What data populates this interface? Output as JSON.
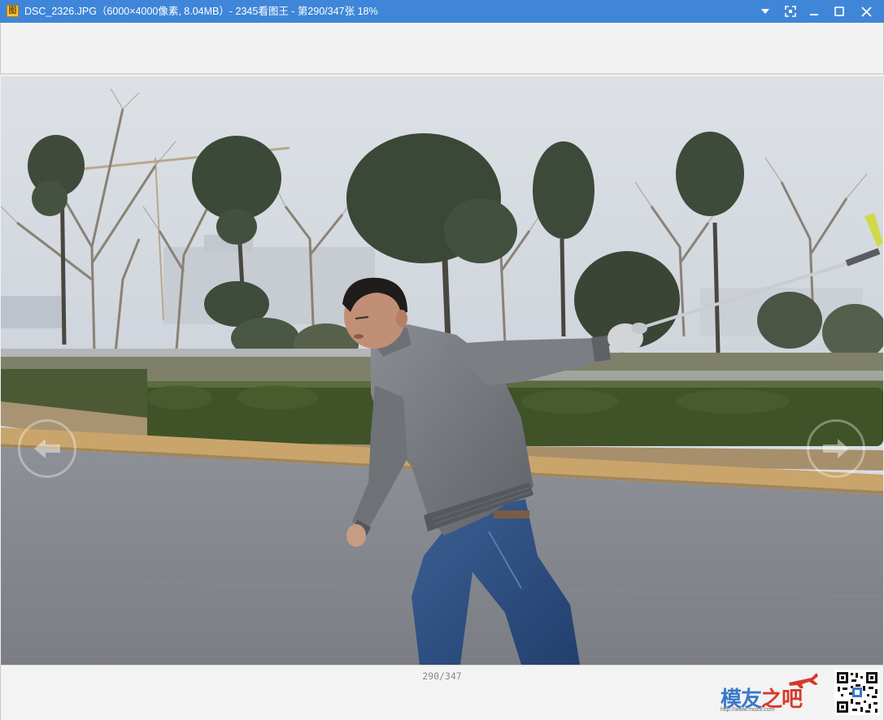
{
  "window": {
    "title": "DSC_2326.JPG（6000×4000像素, 8.04MB）- 2345看图王 - 第290/347张 18%",
    "app_icon_glyph": "图",
    "controls": [
      "dropdown-icon",
      "fullscreen-icon",
      "minimize-icon",
      "maximize-icon",
      "close-icon"
    ]
  },
  "colors": {
    "titlebar": "#3f86d8",
    "status_text": "#8a8a8a",
    "logo_blue": "#3a78c9",
    "logo_red": "#d63a2a"
  },
  "viewer": {
    "prev_icon": "arrow-left-icon",
    "next_icon": "arrow-right-icon",
    "page_indicator": "290/347"
  },
  "watermark": {
    "logo_main": "模友",
    "logo_tail": "之吧",
    "logo_url": "http://www.moz8.com"
  }
}
